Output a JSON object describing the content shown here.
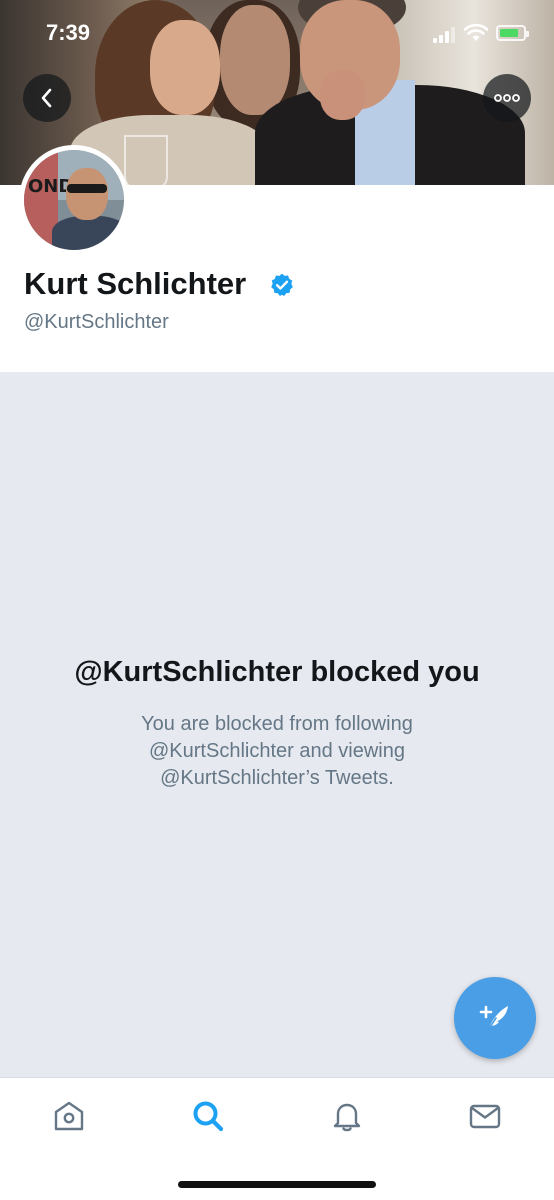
{
  "status_bar": {
    "time": "7:39"
  },
  "profile": {
    "display_name": "Kurt Schlichter",
    "handle": "@KurtSchlichter",
    "verified": true,
    "avatar_poster_text": "OND"
  },
  "blocked": {
    "title": "@KurtSchlichter blocked you",
    "description": "You are blocked from following @KurtSchlichter and viewing @KurtSchlichter’s Tweets."
  },
  "tabs": [
    {
      "name": "home",
      "icon": "home-icon",
      "active": false
    },
    {
      "name": "search",
      "icon": "search-icon",
      "active": true
    },
    {
      "name": "notifications",
      "icon": "bell-icon",
      "active": false
    },
    {
      "name": "messages",
      "icon": "mail-icon",
      "active": false
    }
  ],
  "colors": {
    "accent": "#1da1f2",
    "fab": "#4a9ee6",
    "blocked_background": "#e6e9ef",
    "secondary_text": "#657786",
    "inactive_icon": "#657786"
  },
  "fab": {
    "icon": "compose-tweet-icon"
  }
}
